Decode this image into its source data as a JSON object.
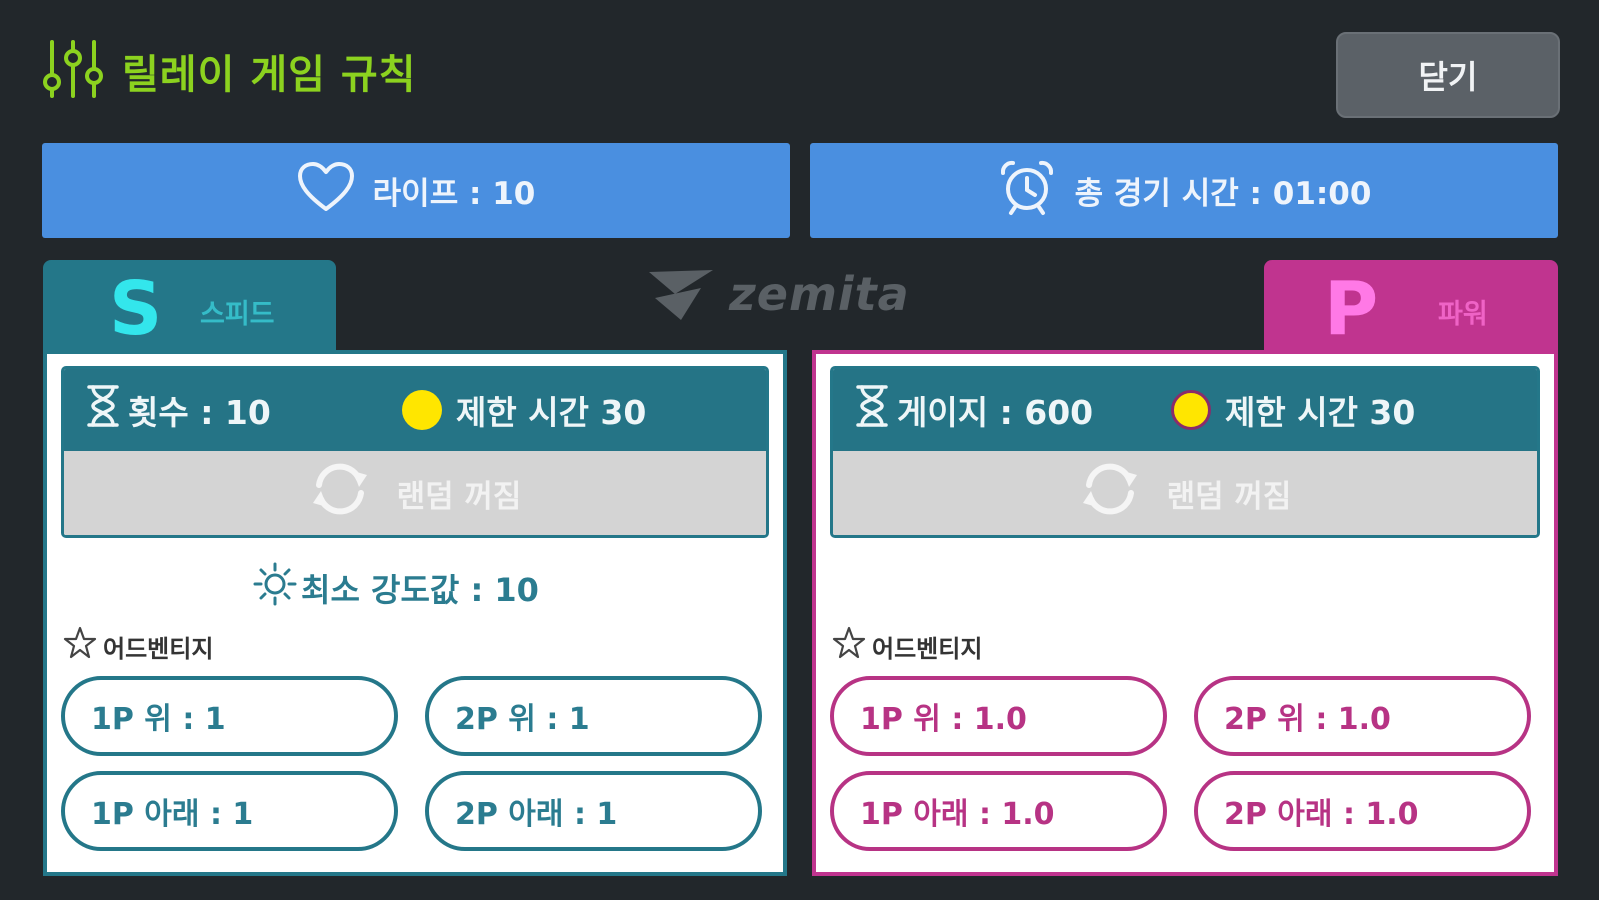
{
  "header": {
    "title": "릴레이 게임 규칙",
    "title_icon": "sliders-icon",
    "close_label": "닫기"
  },
  "info": {
    "life": {
      "icon": "heart-icon",
      "label": "라이프 : 10"
    },
    "total_time": {
      "icon": "alarm-clock-icon",
      "label": "총 경기 시간 : 01:00"
    }
  },
  "logo": {
    "text": "zemita"
  },
  "speed": {
    "letter": "S",
    "name": "스피드",
    "count_label": "횟수 : 10",
    "time_limit_label": "제한 시간 30",
    "random_label": "랜덤 꺼짐",
    "min_intensity_label": "최소 강도값 : 10",
    "advantage_label": "어드벤티지",
    "advantages": [
      "1P 위 : 1",
      "2P 위 : 1",
      "1P 아래 : 1",
      "2P 아래 : 1"
    ]
  },
  "power": {
    "letter": "P",
    "name": "파워",
    "gauge_label": "게이지 : 600",
    "time_limit_label": "제한 시간 30",
    "random_label": "랜덤 꺼짐",
    "advantage_label": "어드벤티지",
    "advantages": [
      "1P 위 : 1.0",
      "2P 위 : 1.0",
      "1P 아래 : 1.0",
      "2P 아래 : 1.0"
    ]
  },
  "colors": {
    "background": "#22272b",
    "title_green": "#8cd21f",
    "info_blue": "#4a8fe0",
    "speed_teal": "#247789",
    "power_pink": "#c0348f",
    "timer_dot": "#ffe600"
  }
}
